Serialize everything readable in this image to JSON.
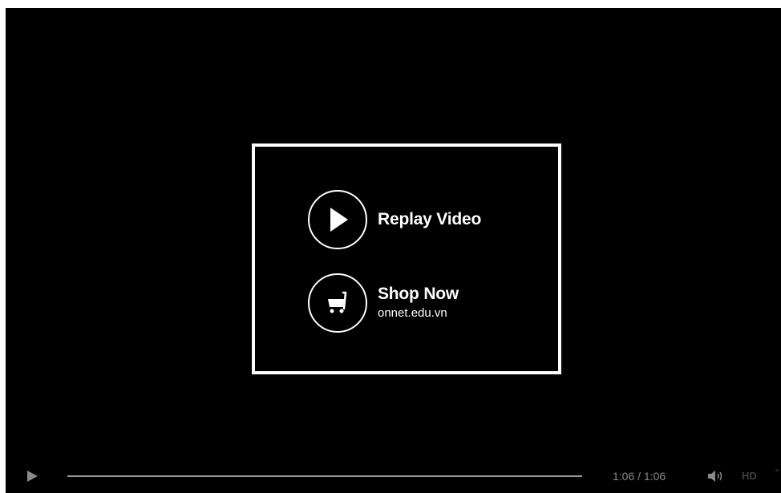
{
  "endcard": {
    "replay": {
      "label": "Replay Video",
      "icon": "play-icon"
    },
    "shop": {
      "label": "Shop Now",
      "sublabel": "onnet.edu.vn",
      "icon": "shopping-cart-icon"
    }
  },
  "controls": {
    "play_icon": "play-icon",
    "time": "1:06 / 1:06",
    "progress": 1.0,
    "volume_icon": "volume-icon",
    "hd_label": "HD",
    "more_label": "\""
  },
  "colors": {
    "background": "#000000",
    "foreground": "#ffffff",
    "control_text": "#8a8a8a"
  }
}
